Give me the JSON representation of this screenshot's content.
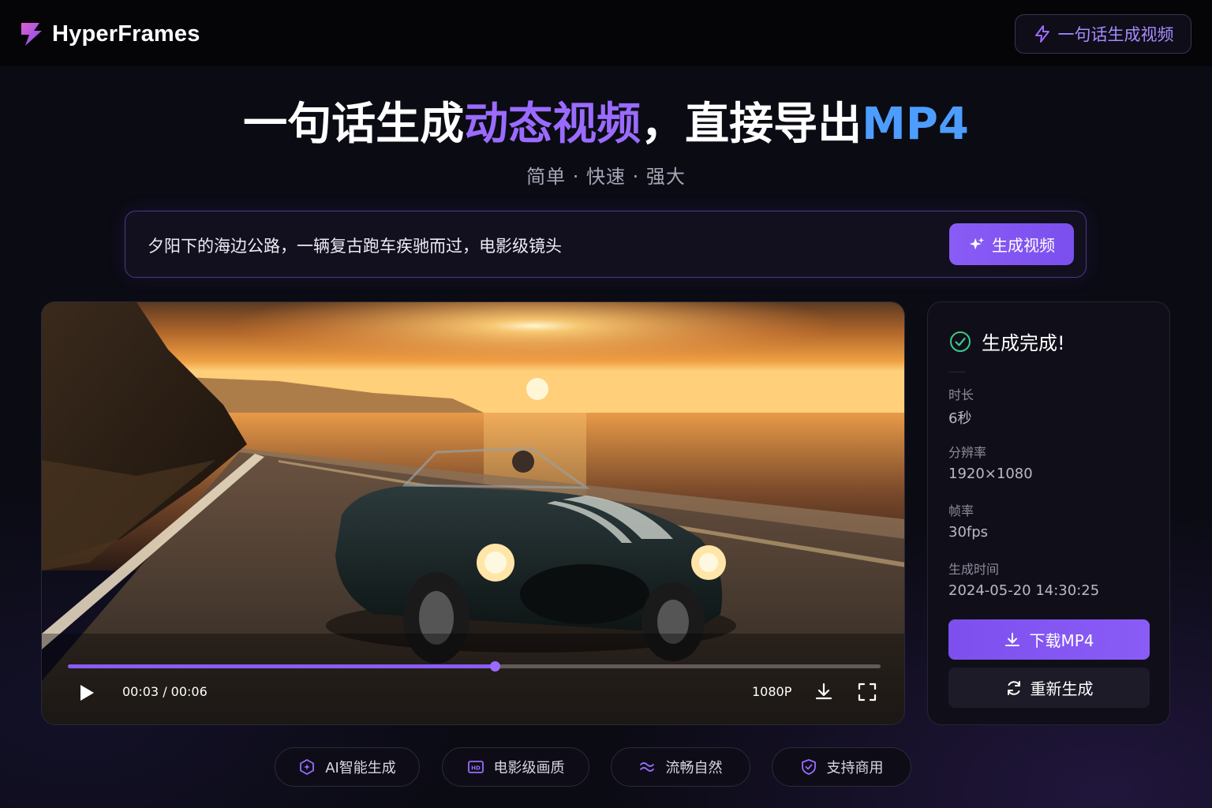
{
  "app": {
    "name": "HyperFrames",
    "cta_label": "一句话生成视频"
  },
  "hero": {
    "title_part1": "一句话生成",
    "title_part2": "动态视频",
    "title_part3": "，直接导出",
    "title_part4": "MP4",
    "subtitle": "简单 · 快速 · 强大"
  },
  "prompt": {
    "text": "夕阳下的海边公路，一辆复古跑车疾驰而过，电影级镜头",
    "generate_label": "生成视频"
  },
  "player": {
    "progress": 0.525,
    "time_display": "00:03 / 00:06",
    "quality": "1080P"
  },
  "info": {
    "status": "生成完成!",
    "items": [
      {
        "label": "时长",
        "value": "6秒"
      },
      {
        "label": "分辨率",
        "value": "1920×1080"
      },
      {
        "label": "帧率",
        "value": "30fps"
      },
      {
        "label": "生成时间",
        "value": "2024-05-20 14:30:25"
      }
    ],
    "download_label": "下载MP4",
    "regenerate_label": "重新生成"
  },
  "features": [
    {
      "label": "AI智能生成",
      "icon": "ai-chip-icon"
    },
    {
      "label": "电影级画质",
      "icon": "hd-icon"
    },
    {
      "label": "流畅自然",
      "icon": "wave-icon"
    },
    {
      "label": "支持商用",
      "icon": "shield-check-icon"
    }
  ],
  "colors": {
    "accent_purple": "#8a5cf6",
    "accent_blue": "#4d9dff",
    "success_green": "#3cc98a",
    "background": "#0b0b14"
  }
}
